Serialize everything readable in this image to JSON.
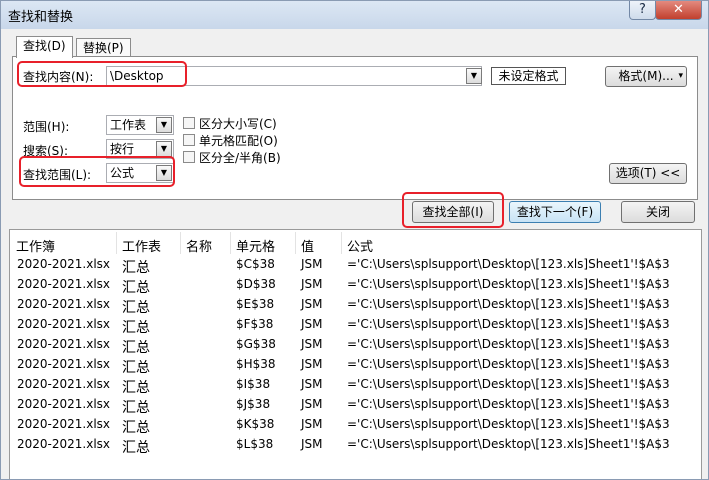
{
  "window": {
    "title": "查找和替换",
    "help_label": "?",
    "close_label": "✕"
  },
  "tabs": [
    {
      "label": "查找(D)"
    },
    {
      "label": "替换(P)"
    }
  ],
  "find": {
    "label": "查找内容(N):",
    "value": "\\Desktop"
  },
  "buttons": {
    "no_format": "未设定格式",
    "format": "格式(M)...",
    "format_arrow": "▾",
    "options": "选项(T) <<",
    "find_all": "查找全部(I)",
    "find_next": "查找下一个(F)",
    "close": "关闭"
  },
  "options": {
    "scope": {
      "label": "范围(H):",
      "value": "工作表"
    },
    "search": {
      "label": "搜索(S):",
      "value": "按行"
    },
    "look_in": {
      "label": "查找范围(L):",
      "value": "公式"
    },
    "match_case": "区分大小写(C)",
    "match_entire": "单元格匹配(O)",
    "match_width": "区分全/半角(B)"
  },
  "results": {
    "columns": [
      "工作簿",
      "工作表",
      "名称",
      "单元格",
      "值",
      "公式"
    ],
    "rows": [
      [
        "2020-2021.xlsx",
        "汇总",
        "",
        "$C$38",
        "JSM",
        "='C:\\Users\\splsupport\\Desktop\\[123.xls]Sheet1'!$A$3"
      ],
      [
        "2020-2021.xlsx",
        "汇总",
        "",
        "$D$38",
        "JSM",
        "='C:\\Users\\splsupport\\Desktop\\[123.xls]Sheet1'!$A$3"
      ],
      [
        "2020-2021.xlsx",
        "汇总",
        "",
        "$E$38",
        "JSM",
        "='C:\\Users\\splsupport\\Desktop\\[123.xls]Sheet1'!$A$3"
      ],
      [
        "2020-2021.xlsx",
        "汇总",
        "",
        "$F$38",
        "JSM",
        "='C:\\Users\\splsupport\\Desktop\\[123.xls]Sheet1'!$A$3"
      ],
      [
        "2020-2021.xlsx",
        "汇总",
        "",
        "$G$38",
        "JSM",
        "='C:\\Users\\splsupport\\Desktop\\[123.xls]Sheet1'!$A$3"
      ],
      [
        "2020-2021.xlsx",
        "汇总",
        "",
        "$H$38",
        "JSM",
        "='C:\\Users\\splsupport\\Desktop\\[123.xls]Sheet1'!$A$3"
      ],
      [
        "2020-2021.xlsx",
        "汇总",
        "",
        "$I$38",
        "JSM",
        "='C:\\Users\\splsupport\\Desktop\\[123.xls]Sheet1'!$A$3"
      ],
      [
        "2020-2021.xlsx",
        "汇总",
        "",
        "$J$38",
        "JSM",
        "='C:\\Users\\splsupport\\Desktop\\[123.xls]Sheet1'!$A$3"
      ],
      [
        "2020-2021.xlsx",
        "汇总",
        "",
        "$K$38",
        "JSM",
        "='C:\\Users\\splsupport\\Desktop\\[123.xls]Sheet1'!$A$3"
      ],
      [
        "2020-2021.xlsx",
        "汇总",
        "",
        "$L$38",
        "JSM",
        "='C:\\Users\\splsupport\\Desktop\\[123.xls]Sheet1'!$A$3"
      ]
    ]
  }
}
